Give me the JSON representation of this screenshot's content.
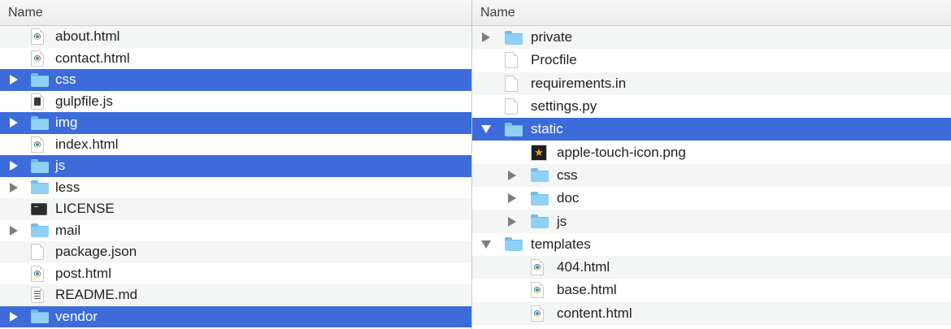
{
  "left": {
    "header": "Name",
    "rows": [
      {
        "name": "about.html",
        "icon": "chrome-html-file-icon",
        "disclosure": "none",
        "selected": false
      },
      {
        "name": "contact.html",
        "icon": "chrome-html-file-icon",
        "disclosure": "none",
        "selected": false
      },
      {
        "name": "css",
        "icon": "folder-icon",
        "disclosure": "closed",
        "selected": true
      },
      {
        "name": "gulpfile.js",
        "icon": "executable-file-icon",
        "disclosure": "none",
        "selected": false
      },
      {
        "name": "img",
        "icon": "folder-icon",
        "disclosure": "closed",
        "selected": true
      },
      {
        "name": "index.html",
        "icon": "chrome-html-file-icon",
        "disclosure": "none",
        "selected": false
      },
      {
        "name": "js",
        "icon": "folder-icon",
        "disclosure": "closed",
        "selected": true
      },
      {
        "name": "less",
        "icon": "folder-icon",
        "disclosure": "closed",
        "selected": false
      },
      {
        "name": "LICENSE",
        "icon": "terminal-file-icon",
        "disclosure": "none",
        "selected": false
      },
      {
        "name": "mail",
        "icon": "folder-icon",
        "disclosure": "closed",
        "selected": false
      },
      {
        "name": "package.json",
        "icon": "document-icon",
        "disclosure": "none",
        "selected": false
      },
      {
        "name": "post.html",
        "icon": "chrome-html-file-icon",
        "disclosure": "none",
        "selected": false
      },
      {
        "name": "README.md",
        "icon": "markdown-file-icon",
        "disclosure": "none",
        "selected": false
      },
      {
        "name": "vendor",
        "icon": "folder-icon",
        "disclosure": "closed",
        "selected": true
      }
    ]
  },
  "right": {
    "header": "Name",
    "rows": [
      {
        "name": "private",
        "icon": "folder-icon",
        "disclosure": "closed",
        "depth": 0,
        "selected": false
      },
      {
        "name": "Procfile",
        "icon": "document-icon",
        "disclosure": "none",
        "depth": 0,
        "selected": false
      },
      {
        "name": "requirements.in",
        "icon": "document-icon",
        "disclosure": "none",
        "depth": 0,
        "selected": false
      },
      {
        "name": "settings.py",
        "icon": "document-icon",
        "disclosure": "none",
        "depth": 0,
        "selected": false
      },
      {
        "name": "static",
        "icon": "folder-icon",
        "disclosure": "open",
        "depth": 0,
        "selected": true
      },
      {
        "name": "apple-touch-icon.png",
        "icon": "image-file-icon",
        "disclosure": "none",
        "depth": 1,
        "selected": false
      },
      {
        "name": "css",
        "icon": "folder-icon",
        "disclosure": "closed",
        "depth": 1,
        "selected": false
      },
      {
        "name": "doc",
        "icon": "folder-icon",
        "disclosure": "closed",
        "depth": 1,
        "selected": false
      },
      {
        "name": "js",
        "icon": "folder-icon",
        "disclosure": "closed",
        "depth": 1,
        "selected": false
      },
      {
        "name": "templates",
        "icon": "folder-icon",
        "disclosure": "open",
        "depth": 0,
        "selected": false
      },
      {
        "name": "404.html",
        "icon": "chrome-html-file-icon",
        "disclosure": "none",
        "depth": 1,
        "selected": false
      },
      {
        "name": "base.html",
        "icon": "chrome-html-file-icon",
        "disclosure": "none",
        "depth": 1,
        "selected": false
      },
      {
        "name": "content.html",
        "icon": "chrome-html-file-icon",
        "disclosure": "none",
        "depth": 1,
        "selected": false
      }
    ]
  },
  "colors": {
    "selection": "#3d6bd9",
    "stripe": "#f4f5f5",
    "folder": "#8fd0f4"
  }
}
